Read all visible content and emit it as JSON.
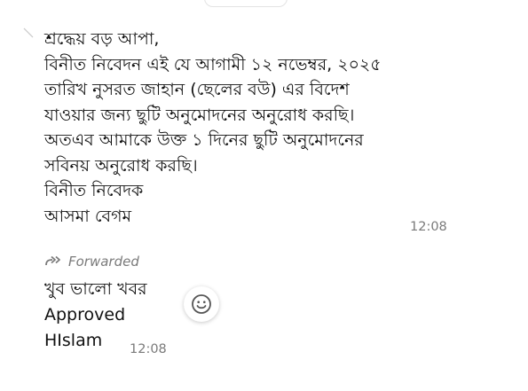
{
  "message1": {
    "lines": [
      "শ্রদ্ধেয় বড় আপা,",
      "বিনীত নিবেদন এই যে আগামী ১২ নভেম্বর, ২০২৫",
      "তারিখ নুসরত জাহান (ছেলের বউ) এর বিদেশ",
      "যাওয়ার জন্য ছুটি অনুমোদনের অনুরোধ করছি।",
      "অতএব আমাকে উক্ত ১ দিনের ছুটি অনুমোদনের",
      "সবিনয় অনুরোধ করছি।",
      "বিনীত নিবেদক",
      "আসমা বেগম"
    ],
    "time": "12:08"
  },
  "message2": {
    "forwarded_label": "Forwarded",
    "lines": [
      "খুব ভালো খবর",
      "Approved",
      "HIslam"
    ],
    "time": "12:08"
  },
  "icons": {
    "forward": "forward-double-arrow-icon",
    "reaction": "smiley-face-icon",
    "tail": "bubble-tail-icon"
  },
  "colors": {
    "text": "#111111",
    "meta": "#7a7a7a",
    "background": "#ffffff"
  }
}
